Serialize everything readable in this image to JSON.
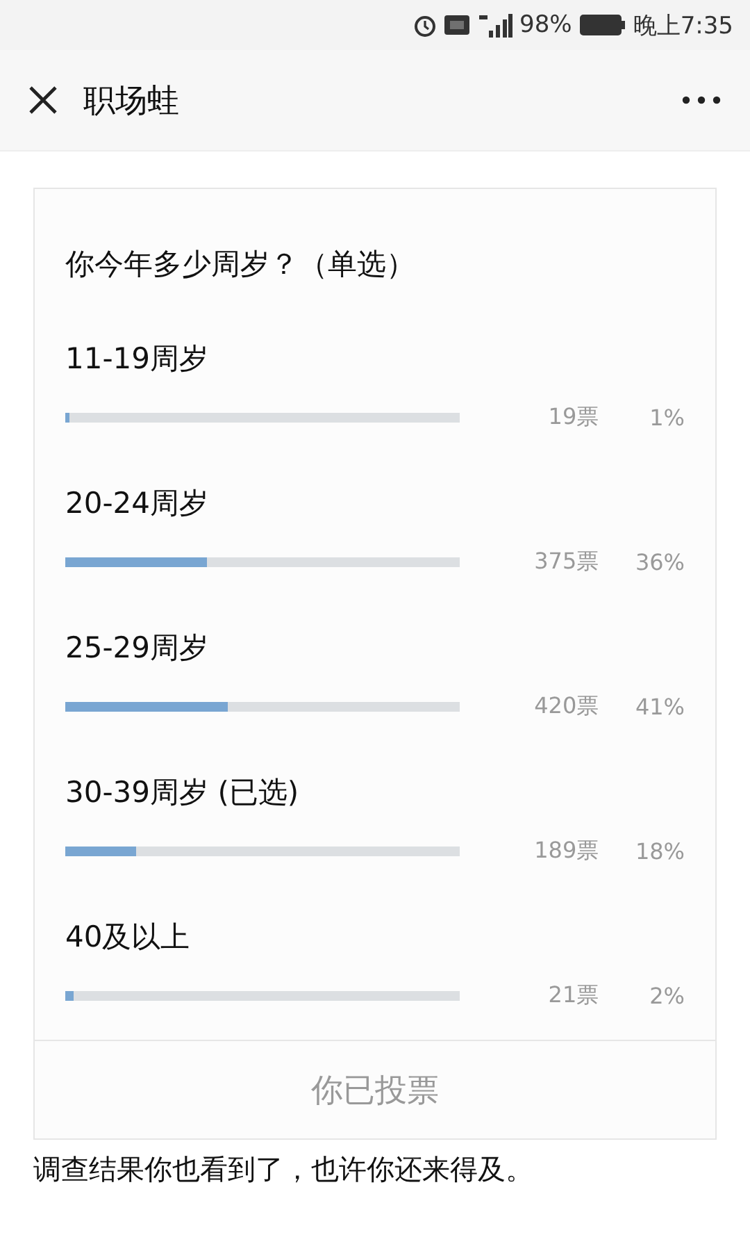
{
  "status_bar": {
    "battery": "98%",
    "time": "晚上7:35"
  },
  "header": {
    "title": "职场蛙"
  },
  "poll": {
    "question": "你今年多少周岁？（单选）",
    "options": [
      {
        "label": "11-19周岁",
        "level": 0.01,
        "votes": "19票",
        "percent": "1%"
      },
      {
        "label": "20-24周岁",
        "level": 0.36,
        "votes": "375票",
        "percent": "36%"
      },
      {
        "label": "25-29周岁",
        "level": 0.41,
        "votes": "420票",
        "percent": "41%"
      },
      {
        "label": "30-39周岁 (已选)",
        "level": 0.18,
        "votes": "189票",
        "percent": "18%"
      },
      {
        "label": "40及以上",
        "level": 0.02,
        "votes": "21票",
        "percent": "2%"
      }
    ],
    "footer": "你已投票"
  },
  "caption": "调查结果你也看到了，也许你还来得及。"
}
